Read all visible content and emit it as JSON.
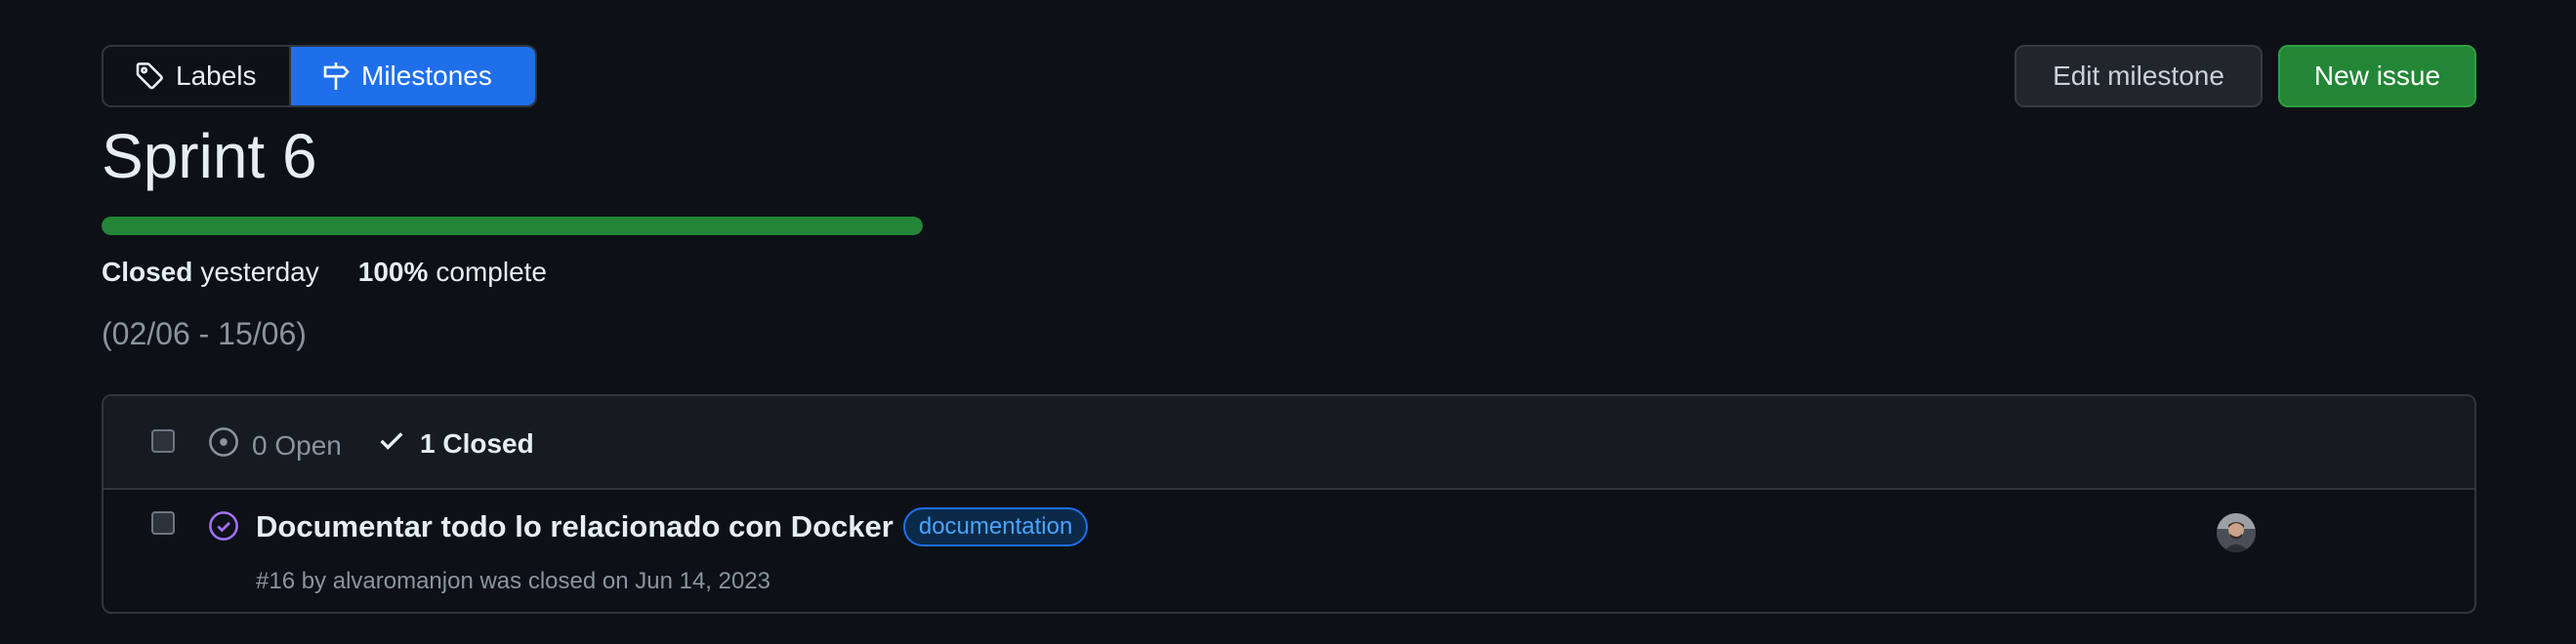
{
  "tabs": {
    "labels": "Labels",
    "milestones": "Milestones"
  },
  "actions": {
    "edit_milestone": "Edit milestone",
    "new_issue": "New issue"
  },
  "milestone": {
    "title": "Sprint 6",
    "progress_percent": 100,
    "status_word": "Closed",
    "status_when": "yesterday",
    "percent_text": "100%",
    "complete_text": "complete",
    "date_range": "(02/06 - 15/06)"
  },
  "issues_filter": {
    "open_label": "0 Open",
    "closed_label": "1 Closed"
  },
  "issues": [
    {
      "title": "Documentar todo lo relacionado con Docker",
      "label": "documentation",
      "meta": "#16 by alvaromanjon was closed on Jun 14, 2023"
    }
  ],
  "colors": {
    "background": "#0d1117",
    "accent_blue": "#1f6feb",
    "success_green": "#238636",
    "closed_purple": "#a371f7",
    "muted_text": "#8b949e"
  },
  "icons": {
    "labels_tab": "tag-icon",
    "milestones_tab": "milestone-icon",
    "open_filter": "issue-open-icon",
    "closed_filter": "check-icon",
    "issue_state": "issue-closed-icon"
  }
}
